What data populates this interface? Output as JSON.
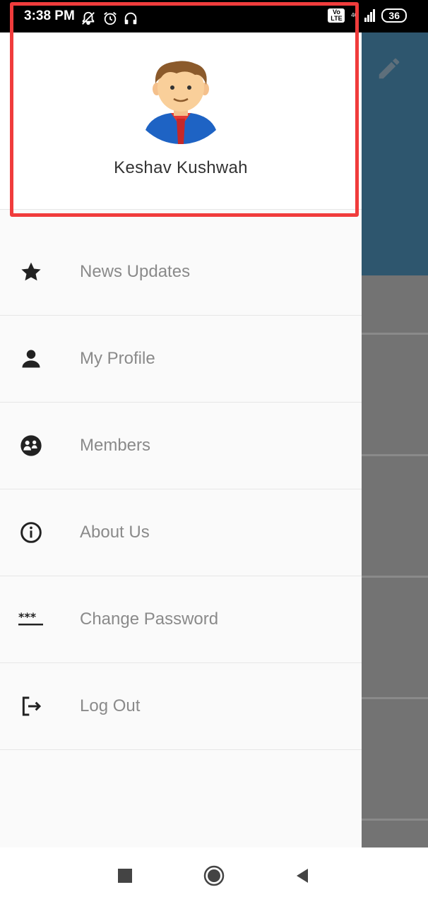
{
  "status_bar": {
    "time": "3:38 PM",
    "volte": "Vo LTE",
    "network": "4G",
    "battery": "36",
    "icons": [
      "mute-icon",
      "alarm-icon",
      "headset-icon",
      "signal-icon"
    ]
  },
  "drawer": {
    "user_name": "Keshav Kushwah",
    "items": [
      {
        "label": "News Updates",
        "icon": "star-icon"
      },
      {
        "label": "My Profile",
        "icon": "person-icon"
      },
      {
        "label": "Members",
        "icon": "members-icon"
      },
      {
        "label": "About Us",
        "icon": "info-icon"
      },
      {
        "label": "Change Password",
        "icon": "password-icon"
      },
      {
        "label": "Log Out",
        "icon": "logout-icon"
      }
    ]
  },
  "background": {
    "header_color": "#2e566e",
    "overlay_color": "#737373"
  },
  "highlight_color": "#f03c3c"
}
